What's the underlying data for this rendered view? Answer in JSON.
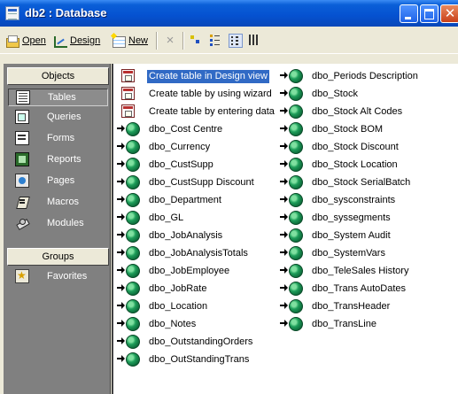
{
  "window": {
    "title": "db2 : Database"
  },
  "toolbar": {
    "open_label": "Open",
    "design_label": "Design",
    "new_label": "New",
    "delete_icon": "×"
  },
  "object_bar": {
    "objects_header": "Objects",
    "items": [
      {
        "label": "Tables",
        "icon": "table-icon"
      },
      {
        "label": "Queries",
        "icon": "query-icon"
      },
      {
        "label": "Forms",
        "icon": "form-icon"
      },
      {
        "label": "Reports",
        "icon": "report-icon"
      },
      {
        "label": "Pages",
        "icon": "page-icon"
      },
      {
        "label": "Macros",
        "icon": "macro-icon"
      },
      {
        "label": "Modules",
        "icon": "module-icon"
      }
    ],
    "groups_header": "Groups",
    "groups": [
      {
        "label": "Favorites",
        "icon": "favorites-icon"
      }
    ]
  },
  "list": {
    "shortcuts": [
      "Create table in Design view",
      "Create table by using wizard",
      "Create table by entering data"
    ],
    "col1_tables": [
      "dbo_Cost Centre",
      "dbo_Currency",
      "dbo_CustSupp",
      "dbo_CustSupp Discount",
      "dbo_Department",
      "dbo_GL",
      "dbo_JobAnalysis",
      "dbo_JobAnalysisTotals",
      "dbo_JobEmployee",
      "dbo_JobRate",
      "dbo_Location",
      "dbo_Notes",
      "dbo_OutstandingOrders",
      "dbo_OutStandingTrans"
    ],
    "col2_tables": [
      "dbo_Periods Description",
      "dbo_Stock",
      "dbo_Stock Alt Codes",
      "dbo_Stock BOM",
      "dbo_Stock Discount",
      "dbo_Stock Location",
      "dbo_Stock SerialBatch",
      "dbo_sysconstraints",
      "dbo_syssegments",
      "dbo_System Audit",
      "dbo_SystemVars",
      "dbo_TeleSales History",
      "dbo_Trans AutoDates",
      "dbo_TransHeader",
      "dbo_TransLine"
    ]
  }
}
